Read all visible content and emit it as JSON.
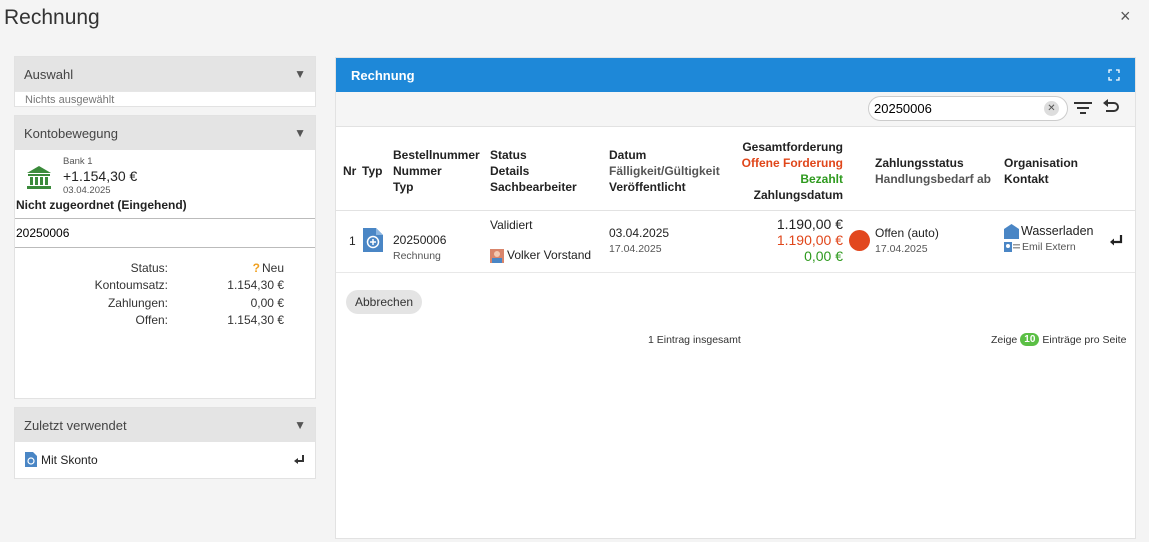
{
  "window": {
    "title": "Rechnung",
    "close_label": "×"
  },
  "left": {
    "auswahl": {
      "header": "Auswahl",
      "value": "Nichts ausgewählt"
    },
    "konto": {
      "header": "Kontobewegung",
      "bank_name": "Bank 1",
      "amount": "+1.154,30 €",
      "date": "03.04.2025",
      "assignment": "Nicht zugeordnet (Eingehend)",
      "input_value": "20250006",
      "stats": [
        {
          "label": "Status:",
          "value": "Neu"
        },
        {
          "label": "Kontoumsatz:",
          "value": "1.154,30 €"
        },
        {
          "label": "Zahlungen:",
          "value": "0,00 €"
        },
        {
          "label": "Offen:",
          "value": "1.154,30 €"
        }
      ]
    },
    "zuletzt": {
      "header": "Zuletzt verwendet",
      "item": "Mit Skonto"
    }
  },
  "main": {
    "header": "Rechnung",
    "search_value": "20250006",
    "columns": {
      "nr": "Nr",
      "typ": "Typ",
      "bestell": [
        "Bestellnummer",
        "Nummer",
        "Typ"
      ],
      "status": [
        "Status",
        "Details",
        "Sachbearbeiter"
      ],
      "datum": [
        "Datum",
        "Fälligkeit/Gültigkeit",
        "Veröffentlicht"
      ],
      "gesamt": [
        "Gesamtforderung",
        "Offene Forderung",
        "Bezahlt",
        "Zahlungsdatum"
      ],
      "zahlung": [
        "Zahlungsstatus",
        "Handlungsbedarf ab"
      ],
      "org": [
        "Organisation",
        "Kontakt"
      ]
    },
    "rows": [
      {
        "nr": "1",
        "nummer": "20250006",
        "typ": "Rechnung",
        "status": "Validiert",
        "sachbearbeiter": "Volker Vorstand",
        "datum": "03.04.2025",
        "faelligkeit": "17.04.2025",
        "gesamt": "1.190,00 €",
        "offen": "1.190,00 €",
        "bezahlt": "0,00 €",
        "zahlungsstatus": "Offen (auto)",
        "handlungsbedarf": "17.04.2025",
        "organisation": "Wasserladen",
        "kontakt": "Emil Extern"
      }
    ],
    "cancel_label": "Abbrechen",
    "count_text": "1 Eintrag insgesamt",
    "pager": {
      "prefix": "Zeige",
      "count": "10",
      "suffix": "Einträge pro Seite"
    }
  },
  "colors": {
    "accent": "#1e88d8",
    "red": "#e0461a",
    "green": "#2e9a1e"
  },
  "icons": [
    "close-icon",
    "bank-icon",
    "question-icon",
    "document-icon",
    "filter-icon",
    "undo-icon",
    "expand-icon",
    "enter-icon",
    "building-icon",
    "contact-icon",
    "avatar-icon"
  ]
}
